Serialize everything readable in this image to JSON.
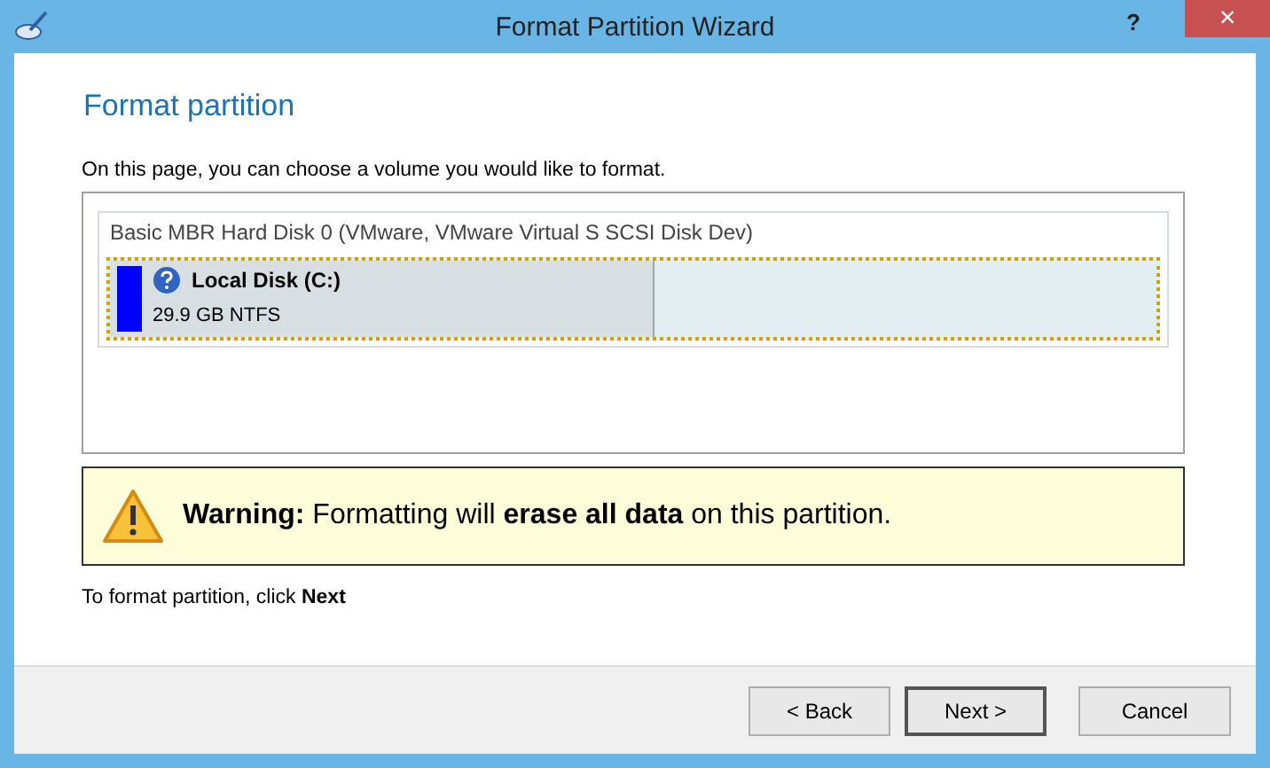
{
  "window": {
    "title": "Format Partition Wizard",
    "help": "?",
    "close": "×"
  },
  "heading": "Format partition",
  "intro": "On this page, you can choose a volume you would like to format.",
  "disk": {
    "title": "Basic MBR Hard Disk 0 (VMware, VMware Virtual S SCSI Disk Dev)",
    "partitions": [
      {
        "name": "Local Disk (C:)",
        "info": "29.9 GB NTFS",
        "selected": true,
        "level": 0.52,
        "color": "#0000ff"
      }
    ]
  },
  "warning": "**Warning:** Formatting will **erase all data** on this partition.",
  "hint": "To format partition, click **Next**",
  "buttons": [
    {
      "label": "< Back",
      "default": false
    },
    {
      "label": "Next >",
      "default": true
    },
    {
      "label": "Cancel",
      "default": false
    }
  ]
}
